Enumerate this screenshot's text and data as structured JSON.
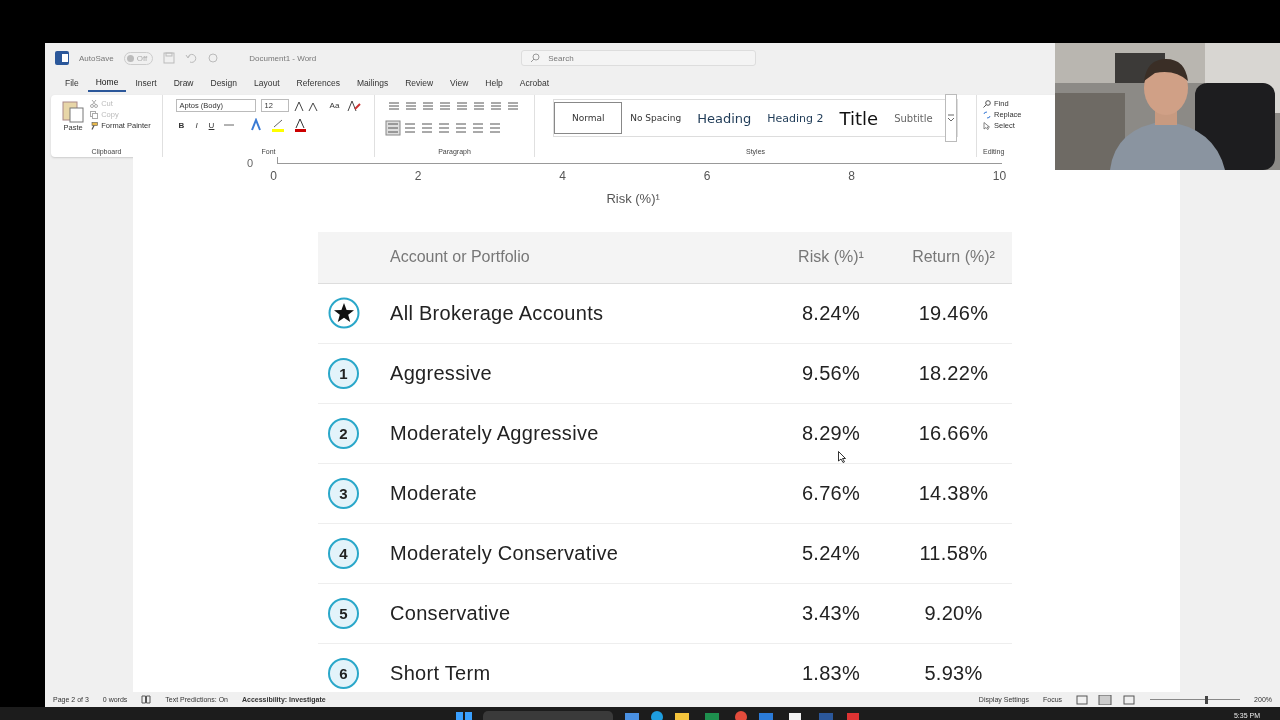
{
  "window": {
    "title": "Document1 - Word",
    "autosave_label": "AutoSave",
    "autosave": {
      "on": false,
      "label": "Off"
    },
    "search": {
      "placeholder": "Search"
    }
  },
  "tabs": [
    {
      "label": "File",
      "selected": false
    },
    {
      "label": "Home",
      "selected": true
    },
    {
      "label": "Insert",
      "selected": false
    },
    {
      "label": "Draw",
      "selected": false
    },
    {
      "label": "Design",
      "selected": false
    },
    {
      "label": "Layout",
      "selected": false
    },
    {
      "label": "References",
      "selected": false
    },
    {
      "label": "Mailings",
      "selected": false
    },
    {
      "label": "Review",
      "selected": false
    },
    {
      "label": "View",
      "selected": false
    },
    {
      "label": "Help",
      "selected": false
    },
    {
      "label": "Acrobat",
      "selected": false
    }
  ],
  "ribbon": {
    "clipboard": {
      "label": "Clipboard",
      "paste": "Paste",
      "cut": "Cut",
      "copy": "Copy",
      "format_painter": "Format Painter"
    },
    "font": {
      "label": "Font",
      "family": "Aptos (Body)",
      "size": "12",
      "case": "Aa",
      "format_buttons": [
        "B",
        "I",
        "U"
      ]
    },
    "paragraph": {
      "label": "Paragraph"
    },
    "styles": {
      "label": "Styles",
      "items": [
        {
          "label": "Normal",
          "kind": "normal",
          "selected": true
        },
        {
          "label": "No Spacing",
          "kind": "normal",
          "selected": false
        },
        {
          "label": "Heading",
          "kind": "heading1",
          "selected": false
        },
        {
          "label": "Heading 2",
          "kind": "heading2",
          "selected": false
        },
        {
          "label": "Title",
          "kind": "title",
          "selected": false
        },
        {
          "label": "Subtitle",
          "kind": "subtitle",
          "selected": false
        }
      ]
    },
    "editing": {
      "label": "Editing",
      "find": "Find",
      "replace": "Replace",
      "select": "Select"
    }
  },
  "chart_axis": {
    "y_tick": "0",
    "x_ticks": [
      "0",
      "2",
      "4",
      "6",
      "8",
      "10"
    ],
    "xlabel": "Risk (%)¹"
  },
  "table": {
    "columns": [
      "Account or Portfolio",
      "Risk (%)¹",
      "Return (%)²"
    ],
    "rows": [
      {
        "kind": "star",
        "badge": "",
        "name": "All Brokerage Accounts",
        "risk": "8.24%",
        "return": "19.46%"
      },
      {
        "kind": "number",
        "badge": "1",
        "name": "Aggressive",
        "risk": "9.56%",
        "return": "18.22%"
      },
      {
        "kind": "number",
        "badge": "2",
        "name": "Moderately Aggressive",
        "risk": "8.29%",
        "return": "16.66%"
      },
      {
        "kind": "number",
        "badge": "3",
        "name": "Moderate",
        "risk": "6.76%",
        "return": "14.38%"
      },
      {
        "kind": "number",
        "badge": "4",
        "name": "Moderately Conservative",
        "risk": "5.24%",
        "return": "11.58%"
      },
      {
        "kind": "number",
        "badge": "5",
        "name": "Conservative",
        "risk": "3.43%",
        "return": "9.20%"
      },
      {
        "kind": "number",
        "badge": "6",
        "name": "Short Term",
        "risk": "1.83%",
        "return": "5.93%"
      }
    ]
  },
  "status_bar": {
    "page": "Page 2 of 3",
    "words": "0 words",
    "text_predictions": "Text Predictions: On",
    "accessibility": "Accessibility: Investigate",
    "display_settings": "Display Settings",
    "focus": "Focus",
    "zoom": "200%",
    "zoom_slider": {
      "level": 0.62
    }
  },
  "taskbar": {
    "time": "5:35 PM"
  }
}
